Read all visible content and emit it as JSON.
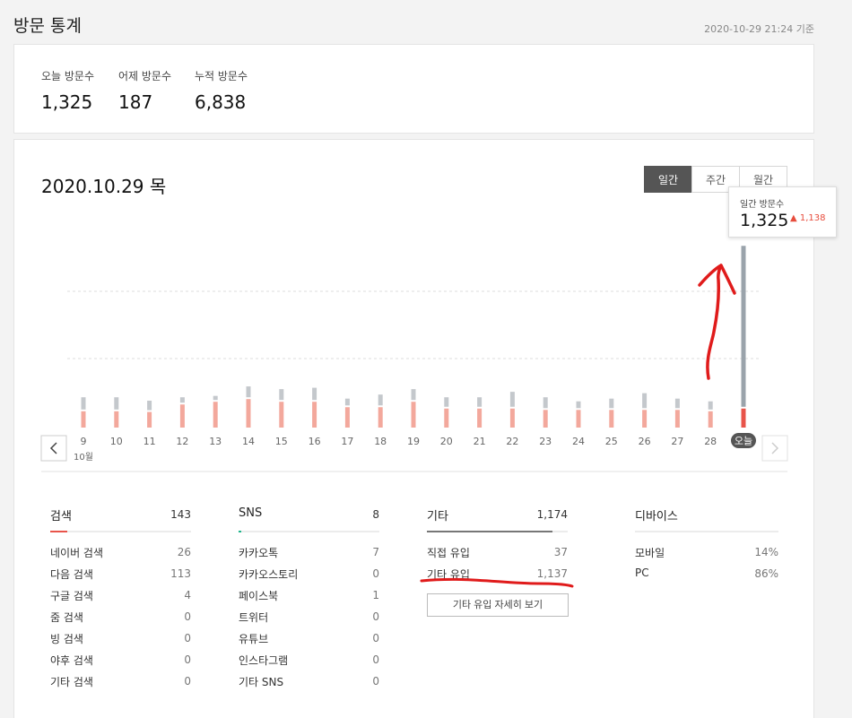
{
  "page": {
    "title": "방문 통계",
    "updated": "2020-10-29 21:24 기준"
  },
  "summary": [
    {
      "label": "오늘 방문수",
      "value": "1,325"
    },
    {
      "label": "어제 방문수",
      "value": "187"
    },
    {
      "label": "누적 방문수",
      "value": "6,838"
    }
  ],
  "main": {
    "date_title": "2020.10.29 목",
    "period_tabs": [
      {
        "label": "일간",
        "active": true
      },
      {
        "label": "주간",
        "active": false
      },
      {
        "label": "월간",
        "active": false
      }
    ],
    "tooltip": {
      "label": "일간 방문수",
      "value": "1,325",
      "change": "1,138"
    },
    "prev_icon": "chevron-left-icon",
    "next_icon": "chevron-right-icon"
  },
  "chart_data": {
    "type": "bar",
    "stacked": true,
    "categories": [
      "9",
      "10",
      "11",
      "12",
      "13",
      "14",
      "15",
      "16",
      "17",
      "18",
      "19",
      "20",
      "21",
      "22",
      "23",
      "24",
      "25",
      "26",
      "27",
      "28",
      "오늘"
    ],
    "month_label": "10월",
    "series": [
      {
        "values": [
          120,
          120,
          115,
          170,
          190,
          210,
          190,
          190,
          150,
          150,
          190,
          140,
          140,
          140,
          130,
          130,
          130,
          130,
          130,
          120,
          140
        ]
      },
      {
        "values": [
          90,
          90,
          70,
          40,
          30,
          80,
          80,
          90,
          50,
          80,
          80,
          70,
          70,
          110,
          80,
          50,
          70,
          110,
          70,
          60,
          1185
        ]
      }
    ],
    "colors": {
      "lower": "#f3a89c",
      "upper": "#c4c8cc",
      "today_lower": "#e8544a",
      "today_upper": "#9aa3ab"
    },
    "gridlines": true
  },
  "stats": {
    "search": {
      "label": "검색",
      "count": "143",
      "bar_color": "#e8544a",
      "bar_fraction": 0.12,
      "rows": [
        {
          "label": "네이버 검색",
          "value": "26"
        },
        {
          "label": "다음 검색",
          "value": "113"
        },
        {
          "label": "구글 검색",
          "value": "4"
        },
        {
          "label": "줌 검색",
          "value": "0"
        },
        {
          "label": "빙 검색",
          "value": "0"
        },
        {
          "label": "야후 검색",
          "value": "0"
        },
        {
          "label": "기타 검색",
          "value": "0"
        }
      ]
    },
    "sns": {
      "label": "SNS",
      "count": "8",
      "bar_color": "#21b58c",
      "bar_fraction": 0.02,
      "rows": [
        {
          "label": "카카오톡",
          "value": "7"
        },
        {
          "label": "카카오스토리",
          "value": "0"
        },
        {
          "label": "페이스북",
          "value": "1"
        },
        {
          "label": "트위터",
          "value": "0"
        },
        {
          "label": "유튜브",
          "value": "0"
        },
        {
          "label": "인스타그램",
          "value": "0"
        },
        {
          "label": "기타 SNS",
          "value": "0"
        }
      ]
    },
    "etc": {
      "label": "기타",
      "count": "1,174",
      "bar_color": "#777777",
      "bar_fraction": 0.89,
      "rows": [
        {
          "label": "직접 유입",
          "value": "37"
        },
        {
          "label": "기타 유입",
          "value": "1,137"
        }
      ],
      "detail_button": "기타 유입 자세히 보기"
    },
    "device": {
      "label": "디바이스",
      "rows": [
        {
          "label": "모바일",
          "value": "14%"
        },
        {
          "label": "PC",
          "value": "86%"
        }
      ]
    }
  }
}
